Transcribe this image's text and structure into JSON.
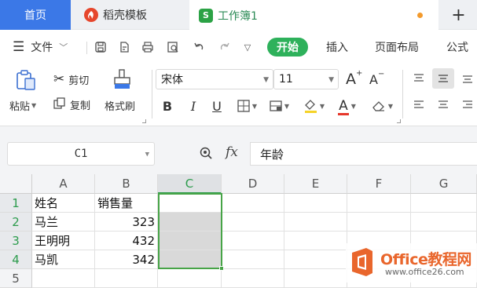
{
  "tabs": {
    "home": "首页",
    "template": "稻壳模板",
    "workbook": "工作簿1",
    "template_icon": "wps-template-icon",
    "workbook_icon_letter": "S",
    "new_tab": "+"
  },
  "menu": {
    "file": "文件",
    "start": "开始",
    "insert": "插入",
    "page_layout": "页面布局",
    "formula": "公式"
  },
  "ribbon": {
    "paste": "粘贴",
    "cut": "剪切",
    "copy": "复制",
    "format_painter": "格式刷",
    "font_name": "宋体",
    "font_size": "11",
    "bold": "B",
    "italic": "I",
    "underline": "U",
    "font_color_glyph": "A",
    "grow_font": "A",
    "shrink_font": "A"
  },
  "formula_bar": {
    "name_box": "C1",
    "fx": "fx",
    "content": "年龄"
  },
  "sheet": {
    "columns": [
      "A",
      "B",
      "C",
      "D",
      "E",
      "F",
      "G"
    ],
    "rows": [
      "1",
      "2",
      "3",
      "4",
      "5"
    ],
    "cells": {
      "A1": "姓名",
      "B1": "销售量",
      "A2": "马兰",
      "B2": "323",
      "A3": "王明明",
      "B3": "432",
      "A4": "马凯",
      "B4": "342"
    },
    "selected_column": "C",
    "selection_color": "#47a447"
  },
  "watermark": {
    "brand": "Office教程网",
    "url": "www.office26.com",
    "color": "#e9662c"
  }
}
